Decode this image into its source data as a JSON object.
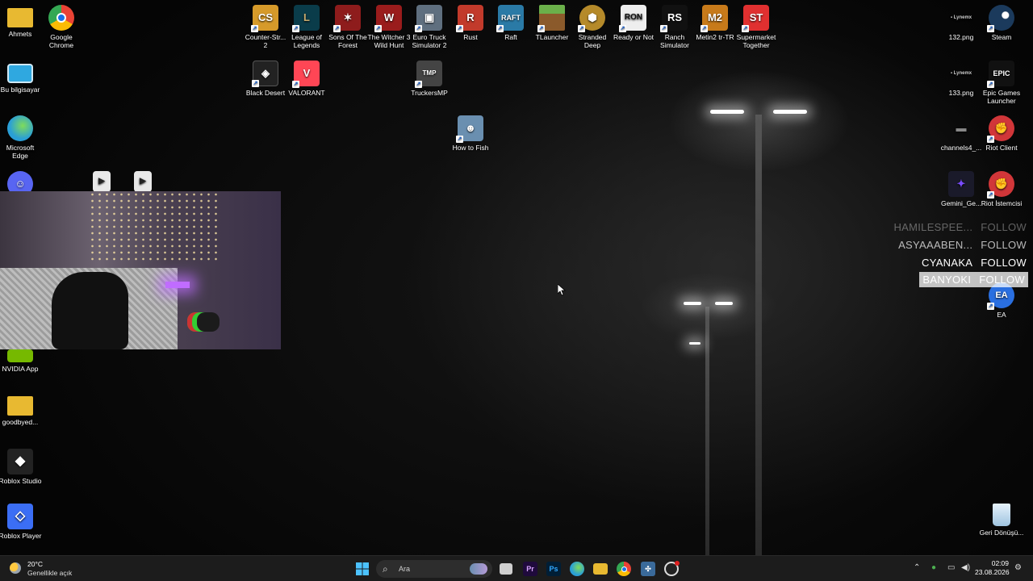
{
  "desktop_icons": [
    {
      "label": "Ahmets",
      "icon": "folder-icon",
      "color": "#e8b931"
    },
    {
      "label": "Google Chrome",
      "icon": "chrome-icon",
      "color": "#1a73e8"
    },
    {
      "label": "Bu bilgisayar",
      "icon": "monitor-icon",
      "color": "#2fa8e0"
    },
    {
      "label": "Microsoft Edge",
      "icon": "edge-icon",
      "color": "#2a9fd6"
    },
    {
      "label": "NVIDIA App",
      "icon": "nvidia-icon",
      "color": "#76b900"
    },
    {
      "label": "goodbyed...",
      "icon": "folder-icon",
      "color": "#e8b931"
    },
    {
      "label": "Roblox Studio",
      "icon": "roblox-studio-icon",
      "color": "#222222"
    },
    {
      "label": "Roblox Player",
      "icon": "roblox-player-icon",
      "color": "#3b6ef5"
    },
    {
      "label": "Counter-Str... 2",
      "icon": "cs2-icon",
      "color": "#d69a2a"
    },
    {
      "label": "League of Legends",
      "icon": "league-icon",
      "color": "#0a3c4a"
    },
    {
      "label": "Sons Of The Forest",
      "icon": "sons-forest-icon",
      "color": "#8e1c1c"
    },
    {
      "label": "The Witcher 3 Wild Hunt",
      "icon": "witcher-icon",
      "color": "#9a1c1c"
    },
    {
      "label": "Euro Truck Simulator 2",
      "icon": "truck-icon",
      "color": "#5f6f7f"
    },
    {
      "label": "Rust",
      "icon": "rust-icon",
      "color": "#c23a2b"
    },
    {
      "label": "Raft",
      "icon": "raft-icon",
      "color": "#2a7aa6"
    },
    {
      "label": "TLauncher",
      "icon": "minecraft-icon",
      "color": "#5a8a3a"
    },
    {
      "label": "Stranded Deep",
      "icon": "stranded-deep-icon",
      "color": "#b58a2a"
    },
    {
      "label": "Ready or Not",
      "icon": "ready-or-not-icon",
      "color": "#eeeeee"
    },
    {
      "label": "Ranch Simulator",
      "icon": "ranch-icon",
      "color": "#111111"
    },
    {
      "label": "Metin2 tr-TR",
      "icon": "metin2-icon",
      "color": "#c77a1a"
    },
    {
      "label": "Supermarket Together",
      "icon": "supermarket-icon",
      "color": "#e03030"
    },
    {
      "label": "Black Desert",
      "icon": "black-desert-icon",
      "color": "#222222"
    },
    {
      "label": "VALORANT",
      "icon": "valorant-icon",
      "color": "#ff4655"
    },
    {
      "label": "TruckersMP",
      "icon": "truckersmp-icon",
      "color": "#444444"
    },
    {
      "label": "How to Fish",
      "icon": "how-to-fish-icon",
      "color": "#6a8fb0"
    },
    {
      "label": "132.png",
      "icon": "image-icon",
      "color": "#ffffff"
    },
    {
      "label": "Steam",
      "icon": "steam-icon",
      "color": "#1b3a5c"
    },
    {
      "label": "133.png",
      "icon": "image-icon",
      "color": "#ffffff"
    },
    {
      "label": "Epic Games Launcher",
      "icon": "epic-icon",
      "color": "#111111"
    },
    {
      "label": "channels4_...",
      "icon": "image-icon",
      "color": "#ffffff"
    },
    {
      "label": "Riot Client",
      "icon": "riot-icon",
      "color": "#d13639"
    },
    {
      "label": "Gemini_Ge...",
      "icon": "gemini-icon",
      "color": "#7a4cff"
    },
    {
      "label": "Riot İstemcisi",
      "icon": "riot-icon",
      "color": "#d13639"
    },
    {
      "label": "EA",
      "icon": "ea-icon",
      "color": "#2a6fe0"
    },
    {
      "label": "Geri Dönüşü...",
      "icon": "recycle-bin-icon",
      "color": "#bcd8f0"
    }
  ],
  "follow_alerts": [
    {
      "name": "HAMILESPEE...",
      "action": "FOLLOW"
    },
    {
      "name": "ASYAAABEN...",
      "action": "FOLLOW"
    },
    {
      "name": "CYANAKA",
      "action": "FOLLOW"
    },
    {
      "name": "BANYOKI",
      "action": "FOLLOW"
    }
  ],
  "taskbar": {
    "weather_temp": "20°C",
    "weather_desc": "Genellikle açık",
    "search_placeholder": "Ara",
    "time": "02:09",
    "date": "23.08.2026"
  }
}
